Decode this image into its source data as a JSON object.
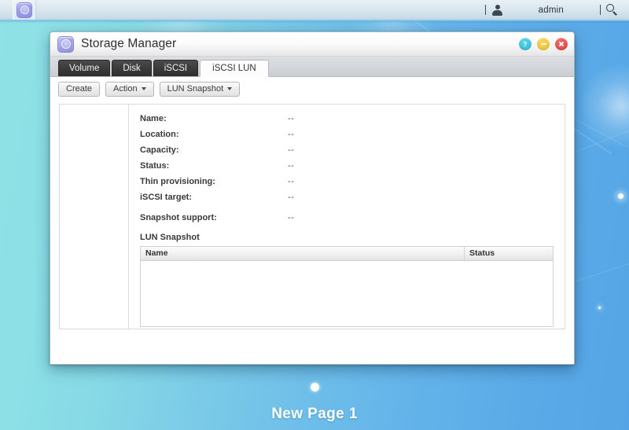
{
  "taskbar": {
    "app_launcher_icon": "app-grid-icon",
    "user_icon": "user-icon",
    "username": "admin",
    "search_icon": "search-icon"
  },
  "window": {
    "icon": "storage-manager-icon",
    "title": "Storage Manager",
    "buttons": {
      "help_label": "?",
      "help_icon": "help-icon",
      "minimize_icon": "minimize-icon",
      "close_icon": "close-icon"
    }
  },
  "tabs": [
    {
      "label": "Volume",
      "active": false
    },
    {
      "label": "Disk",
      "active": false
    },
    {
      "label": "iSCSI",
      "active": false
    },
    {
      "label": "iSCSI LUN",
      "active": true
    }
  ],
  "toolbar": {
    "create_label": "Create",
    "action_label": "Action",
    "lun_snapshot_label": "LUN Snapshot"
  },
  "details": {
    "rows": [
      {
        "label": "Name:",
        "value": "--"
      },
      {
        "label": "Location:",
        "value": "--"
      },
      {
        "label": "Capacity:",
        "value": "--"
      },
      {
        "label": "Status:",
        "value": "--"
      },
      {
        "label": "Thin provisioning:",
        "value": "--"
      },
      {
        "label": "iSCSI target:",
        "value": "--"
      }
    ],
    "snapshot_support": {
      "label": "Snapshot support:",
      "value": "--"
    },
    "section_title": "LUN Snapshot"
  },
  "snapshot_table": {
    "columns": [
      "Name",
      "Status"
    ],
    "rows": []
  },
  "pager": {
    "label": "New Page 1",
    "dot_count": 1
  },
  "colors": {
    "desktop_left": "#8fe3e6",
    "desktop_right": "#55a5e6",
    "tab_active_bg": "#fdfdfd",
    "tab_inactive_bg": "#3b3b3b",
    "help_button": "#2fbcd8",
    "minimize_button": "#eec22f",
    "close_button": "#e04141"
  }
}
